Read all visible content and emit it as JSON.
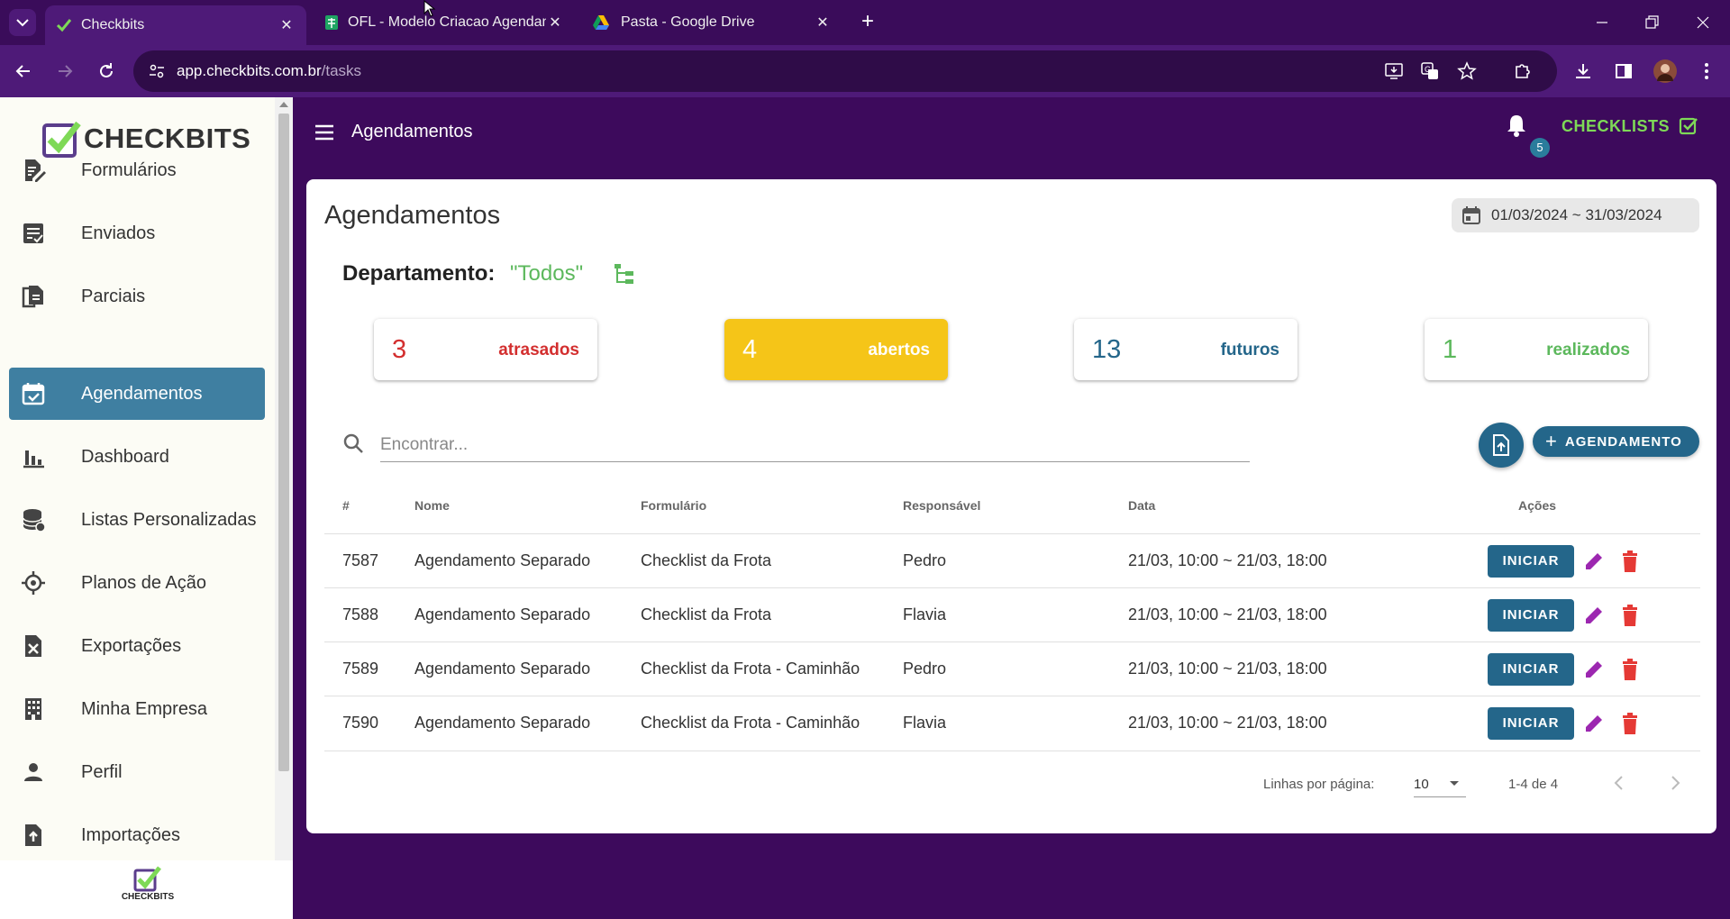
{
  "browser": {
    "tabs": [
      {
        "label": "Checkbits",
        "icon": "checkbits-favicon"
      },
      {
        "label": "OFL - Modelo Criacao Agendam",
        "icon": "sheets-favicon"
      },
      {
        "label": "Pasta - Google Drive",
        "icon": "drive-favicon"
      }
    ],
    "url_host": "app.checkbits.com.br",
    "url_path": "/tasks"
  },
  "header": {
    "title": "Agendamentos",
    "notification_count": "5",
    "checklists_label": "CHECKLISTS"
  },
  "sidebar": {
    "logo_text": "CHECKBITS",
    "items": [
      {
        "label": "Formulários",
        "icon": "form-edit-icon"
      },
      {
        "label": "Enviados",
        "icon": "sent-list-icon"
      },
      {
        "label": "Parciais",
        "icon": "partial-docs-icon"
      },
      {
        "label": "Agendamentos",
        "icon": "calendar-check-icon",
        "active": true
      },
      {
        "label": "Dashboard",
        "icon": "bar-chart-icon"
      },
      {
        "label": "Listas Personalizadas",
        "icon": "database-icon"
      },
      {
        "label": "Planos de Ação",
        "icon": "crosshair-icon"
      },
      {
        "label": "Exportações",
        "icon": "excel-file-icon"
      },
      {
        "label": "Minha Empresa",
        "icon": "building-icon"
      },
      {
        "label": "Perfil",
        "icon": "person-icon"
      },
      {
        "label": "Importações",
        "icon": "file-import-icon"
      }
    ],
    "footer_logo_text": "CHECKBITS"
  },
  "main": {
    "title": "Agendamentos",
    "date_range": "01/03/2024 ~ 31/03/2024",
    "department_label": "Departamento:",
    "department_value": "\"Todos\"",
    "stats": [
      {
        "count": "3",
        "label": "atrasados",
        "color": "#d32f2f"
      },
      {
        "count": "4",
        "label": "abertos",
        "color": "#ffffff",
        "bg": "#f5c518"
      },
      {
        "count": "13",
        "label": "futuros",
        "color": "#24668a"
      },
      {
        "count": "1",
        "label": "realizados",
        "color": "#5cb85c"
      }
    ],
    "search_placeholder": "Encontrar...",
    "add_button_label": "AGENDAMENTO",
    "columns": [
      "#",
      "Nome",
      "Formulário",
      "Responsável",
      "Data",
      "Ações"
    ],
    "rows": [
      {
        "id": "7587",
        "nome": "Agendamento Separado",
        "formulario": "Checklist da Frota",
        "responsavel": "Pedro",
        "data": "21/03, 10:00 ~ 21/03, 18:00"
      },
      {
        "id": "7588",
        "nome": "Agendamento Separado",
        "formulario": "Checklist da Frota",
        "responsavel": "Flavia",
        "data": "21/03, 10:00 ~ 21/03, 18:00"
      },
      {
        "id": "7589",
        "nome": "Agendamento Separado",
        "formulario": "Checklist da Frota - Caminhão",
        "responsavel": "Pedro",
        "data": "21/03, 10:00 ~ 21/03, 18:00"
      },
      {
        "id": "7590",
        "nome": "Agendamento Separado",
        "formulario": "Checklist da Frota - Caminhão",
        "responsavel": "Flavia",
        "data": "21/03, 10:00 ~ 21/03, 18:00"
      }
    ],
    "start_button_label": "INICIAR",
    "pagination": {
      "rows_per_page_label": "Linhas por página:",
      "rows_per_page": "10",
      "range": "1-4 de 4"
    }
  },
  "colors": {
    "brand_purple": "#3d0a5c",
    "primary_blue": "#24668a",
    "edit_purple": "#9c27b0",
    "delete_red": "#e53935"
  }
}
